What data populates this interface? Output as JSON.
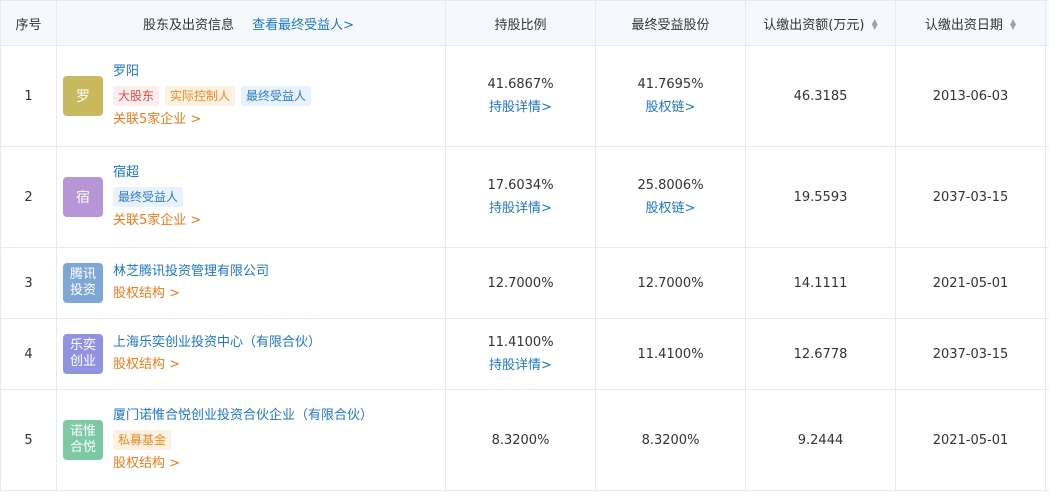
{
  "header": {
    "seq": "序号",
    "holder": "股东及出资信息",
    "ultimate_link": "查看最终受益人>",
    "ratio": "持股比例",
    "benefit": "最终受益股份",
    "amount": "认缴出资额(万元)",
    "date": "认缴出资日期"
  },
  "rows": [
    {
      "seq": "1",
      "avatar": "罗",
      "avatar_color": "#c8b85e",
      "name": "罗阳",
      "tags": [
        "大股东",
        "实际控制人",
        "最终受益人"
      ],
      "related": "关联5家企业 >",
      "ratio": "41.6867%",
      "ratio_link": "持股详情>",
      "benefit": "41.7695%",
      "benefit_link": "股权链>",
      "amount": "46.3185",
      "date": "2013-06-03"
    },
    {
      "seq": "2",
      "avatar": "宿",
      "avatar_color": "#b796d8",
      "name": "宿超",
      "tags": [
        "最终受益人"
      ],
      "related": "关联5家企业 >",
      "ratio": "17.6034%",
      "ratio_link": "持股详情>",
      "benefit": "25.8006%",
      "benefit_link": "股权链>",
      "amount": "19.5593",
      "date": "2037-03-15"
    },
    {
      "seq": "3",
      "avatar_line1": "腾讯",
      "avatar_line2": "投资",
      "avatar_color": "#7fa7d6",
      "name": "林芝腾讯投资管理有限公司",
      "related": "股权结构 >",
      "ratio": "12.7000%",
      "benefit": "12.7000%",
      "amount": "14.1111",
      "date": "2021-05-01"
    },
    {
      "seq": "4",
      "avatar_line1": "乐奕",
      "avatar_line2": "创业",
      "avatar_color": "#8f93e0",
      "name": "上海乐奕创业投资中心（有限合伙）",
      "related": "股权结构 >",
      "ratio": "11.4100%",
      "ratio_link": "持股详情>",
      "benefit": "11.4100%",
      "amount": "12.6778",
      "date": "2037-03-15"
    },
    {
      "seq": "5",
      "avatar_line1": "诺惟",
      "avatar_line2": "合悦",
      "avatar_color": "#7cc9a4",
      "name": "厦门诺惟合悦创业投资合伙企业（有限合伙）",
      "tags": [
        "私募基金"
      ],
      "related": "股权结构 >",
      "ratio": "8.3200%",
      "benefit": "8.3200%",
      "amount": "9.2444",
      "date": "2021-05-01"
    }
  ]
}
